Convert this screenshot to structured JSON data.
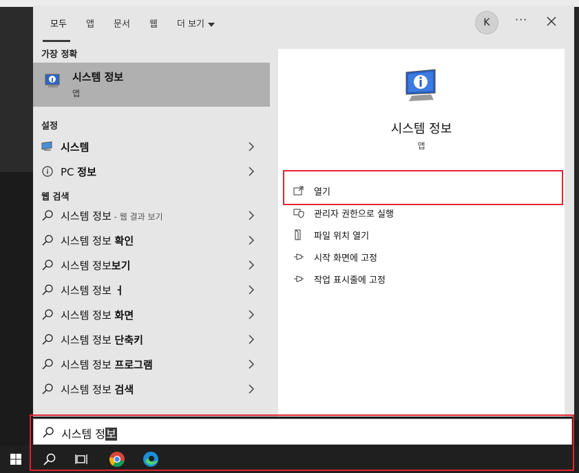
{
  "tabs": [
    "모두",
    "앱",
    "문서",
    "웹",
    "더 보기"
  ],
  "account_initial": "K",
  "more_label": "···",
  "best_match": {
    "heading": "가장 정확",
    "title": "시스템 정보",
    "subtitle": "앱"
  },
  "settings": {
    "heading": "설정",
    "items": [
      {
        "label": "시스템",
        "icon": "monitor-icon"
      },
      {
        "label_plain": "PC ",
        "label_bold": "정보",
        "icon": "info-circle-icon"
      }
    ]
  },
  "web_search": {
    "heading": "웹 검색",
    "items": [
      {
        "plain": "시스템 정보",
        "bold": "",
        "suffix": " - 웹 결과 보기"
      },
      {
        "plain": "시스템 정보 ",
        "bold": "확인",
        "suffix": ""
      },
      {
        "plain": "시스템 정보",
        "bold": "보기",
        "suffix": ""
      },
      {
        "plain": "시스템 정보 ",
        "bold": "ㅓ",
        "suffix": ""
      },
      {
        "plain": "시스템 정보 ",
        "bold": "화면",
        "suffix": ""
      },
      {
        "plain": "시스템 정보 ",
        "bold": "단축키",
        "suffix": ""
      },
      {
        "plain": "시스템 정보 ",
        "bold": "프로그램",
        "suffix": ""
      },
      {
        "plain": "시스템 정보 ",
        "bold": "검색",
        "suffix": ""
      }
    ]
  },
  "preview": {
    "title": "시스템 정보",
    "subtitle": "앱",
    "actions": [
      {
        "label": "열기",
        "icon": "open-icon"
      },
      {
        "label": "관리자 권한으로 실행",
        "icon": "shield-icon"
      },
      {
        "label": "파일 위치 열기",
        "icon": "file-location-icon"
      },
      {
        "label": "시작 화면에 고정",
        "icon": "pin-icon"
      },
      {
        "label": "작업 표시줄에 고정",
        "icon": "pin-icon"
      }
    ]
  },
  "search": {
    "query_prefix": "시스템 정",
    "query_cursor_char": "보"
  },
  "taskbar": {
    "items": [
      "windows-start-icon",
      "search-icon",
      "task-view-icon",
      "chrome-icon",
      "edge-icon"
    ]
  },
  "colors": {
    "highlight_border": "#e0242f",
    "selected_row": "#b0b0b0",
    "panel_bg": "#e6e6e6",
    "taskbar_bg": "#1f1f1f"
  }
}
